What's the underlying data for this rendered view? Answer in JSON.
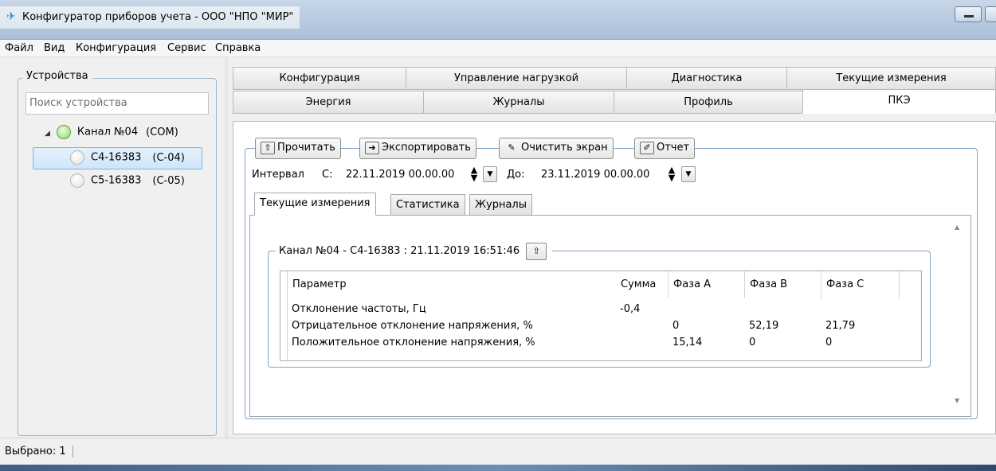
{
  "window": {
    "title": "Конфигуратор приборов учета - ООО \"НПО \"МИР\"",
    "app_icon": "meter-app-icon"
  },
  "menu": [
    "Файл",
    "Вид",
    "Конфигурация",
    "Сервис",
    "Справка"
  ],
  "devices": {
    "group_label": "Устройства",
    "search_placeholder": "Поиск устройства",
    "channel": {
      "name": "Канал №04",
      "port": "(COM)",
      "status_color": "#8fd26b"
    },
    "items": [
      {
        "name": "C4-16383",
        "addr": "(C-04)",
        "selected": true
      },
      {
        "name": "C5-16383",
        "addr": "(C-05)",
        "selected": false
      }
    ]
  },
  "tabs": {
    "row1": [
      "Конфигурация",
      "Управление нагрузкой",
      "Диагностика",
      "Текущие измерения"
    ],
    "row2": [
      "Энергия",
      "Журналы",
      "Профиль",
      "ПКЭ"
    ],
    "active": "ПКЭ"
  },
  "toolbar": {
    "read": "Прочитать",
    "export": "Экспортировать",
    "clear": "Очистить экран",
    "report": "Отчет"
  },
  "interval": {
    "label": "Интервал",
    "from_label": "С:",
    "from_value": "22.11.2019 00.00.00",
    "to_label": "До:",
    "to_value": "23.11.2019 00.00.00"
  },
  "subtabs": [
    "Текущие измерения",
    "Статистика",
    "Журналы"
  ],
  "channel_group": {
    "title": "Канал №04 - C4-16383 : 21.11.2019 16:51:46"
  },
  "grid": {
    "columns": [
      "Параметр",
      "Сумма",
      "Фаза A",
      "Фаза B",
      "Фаза C"
    ],
    "rows": [
      {
        "param": "Отклонение частоты, Гц",
        "sum": "-0,4",
        "a": "",
        "b": "",
        "c": ""
      },
      {
        "param": "Отрицательное отклонение напряжения, %",
        "sum": "",
        "a": "0",
        "b": "52,19",
        "c": "21,79"
      },
      {
        "param": "Положительное отклонение напряжения, %",
        "sum": "",
        "a": "15,14",
        "b": "0",
        "c": "0"
      }
    ]
  },
  "status": {
    "selected": "Выбрано: 1"
  },
  "colors": {
    "accent": "#7da2ce",
    "selection": "#cfe6f9"
  }
}
